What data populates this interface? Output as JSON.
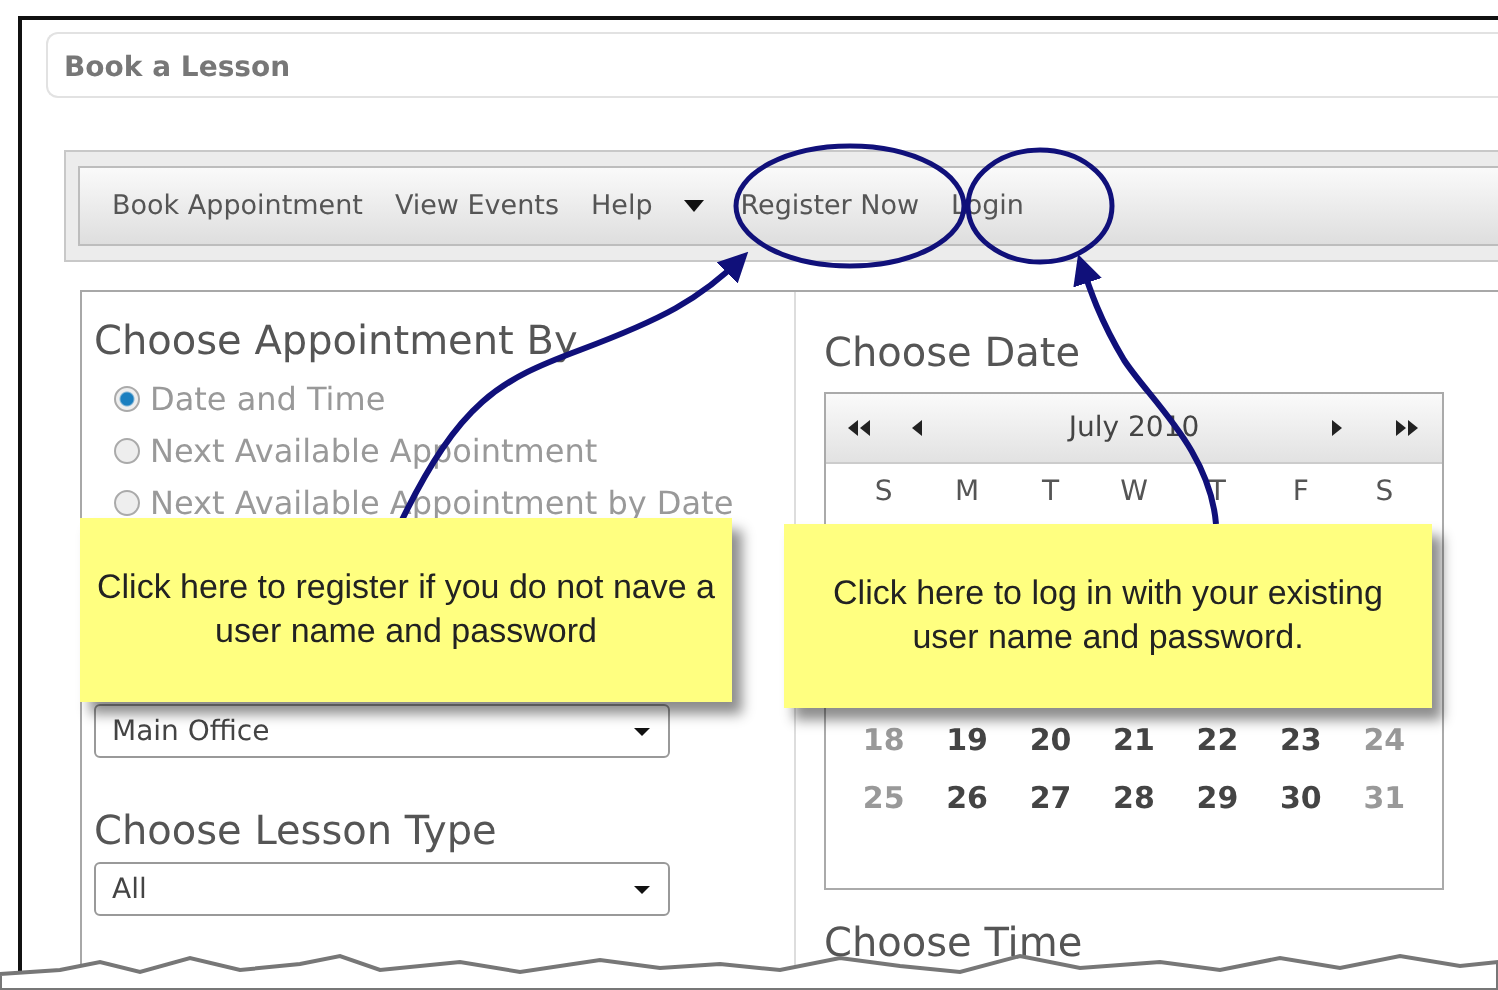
{
  "window": {
    "title": "Book a Lesson"
  },
  "menu": [
    {
      "label": "Book Appointment",
      "kind": "link"
    },
    {
      "label": "View Events",
      "kind": "link"
    },
    {
      "label": "Help",
      "kind": "dropdown"
    },
    {
      "label": "Register Now",
      "kind": "link"
    },
    {
      "label": "Login",
      "kind": "link"
    }
  ],
  "appointment": {
    "heading": "Choose Appointment By",
    "options": [
      {
        "label": "Date and Time",
        "selected": true
      },
      {
        "label": "Next Available Appointment",
        "selected": false
      },
      {
        "label": "Next Available Appointment by Date",
        "selected": false
      }
    ]
  },
  "location": {
    "value": "Main Office"
  },
  "lesson_type": {
    "heading": "Choose Lesson Type",
    "value": "All"
  },
  "date": {
    "heading": "Choose Date",
    "month": "July 2010",
    "weekdays": [
      "S",
      "M",
      "T",
      "W",
      "T",
      "F",
      "S"
    ],
    "weeks": [
      [
        {
          "day": "18",
          "weekend": true
        },
        {
          "day": "19",
          "weekend": false
        },
        {
          "day": "20",
          "weekend": false
        },
        {
          "day": "21",
          "weekend": false
        },
        {
          "day": "22",
          "weekend": false
        },
        {
          "day": "23",
          "weekend": false
        },
        {
          "day": "24",
          "weekend": true
        }
      ],
      [
        {
          "day": "25",
          "weekend": true
        },
        {
          "day": "26",
          "weekend": false
        },
        {
          "day": "27",
          "weekend": false
        },
        {
          "day": "28",
          "weekend": false
        },
        {
          "day": "29",
          "weekend": false
        },
        {
          "day": "30",
          "weekend": false
        },
        {
          "day": "31",
          "weekend": true
        }
      ]
    ]
  },
  "time": {
    "heading": "Choose Time"
  },
  "callouts": [
    {
      "text": "Click here to register if you do not nave a user name and password"
    },
    {
      "text": "Click here to log in with your existing user name and password."
    }
  ]
}
